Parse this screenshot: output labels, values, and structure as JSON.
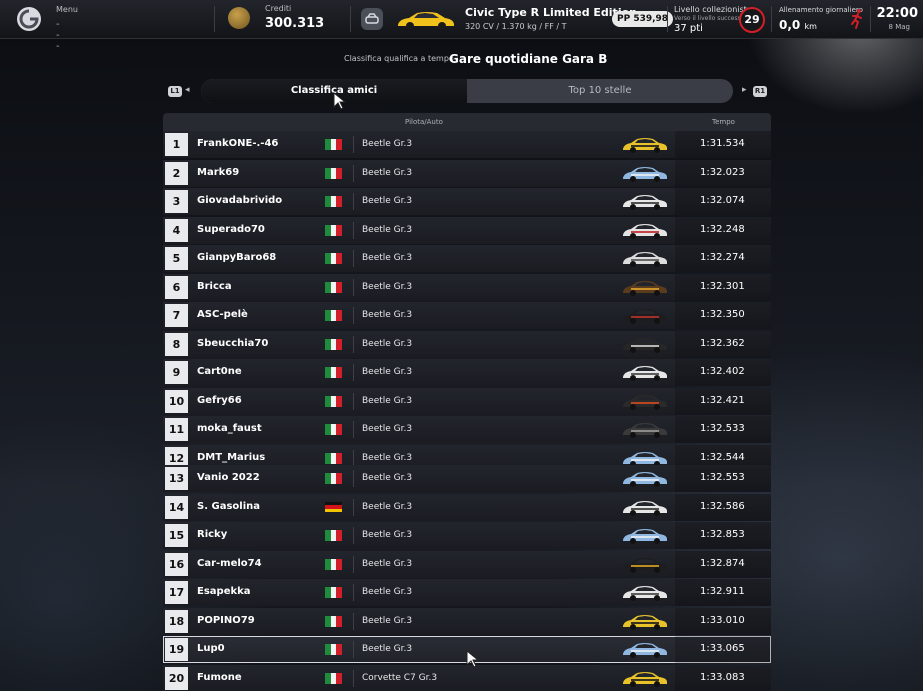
{
  "topbar": {
    "menu_label": "Menu",
    "menu_value": "---",
    "credits_label": "Crediti",
    "credits_value": "300.313",
    "car_name": "Civic Type R Limited Edition ...",
    "car_specs": "320 CV / 1.370 kg / FF / T",
    "pp": "PP 539,98",
    "level_label": "Livello collezionista",
    "level_sub": "Verso il livello successivo",
    "level_pts": "37 pti",
    "level_number": "29",
    "training_label": "Allenamento giornaliero",
    "training_value": "0,0",
    "training_unit": "km",
    "clock_time": "22:00",
    "clock_date": "8 Mag"
  },
  "header": {
    "subtitle": "Classifica qualifica a tempo",
    "title": "Gare quotidiane Gara B"
  },
  "tabs": {
    "left_button": "L1",
    "right_button": "R1",
    "friends": "Classifica amici",
    "top10": "Top 10 stelle"
  },
  "table": {
    "col_driver": "Pilota/Auto",
    "col_time": "Tempo",
    "rows": [
      {
        "pos": "1",
        "name": "FrankONE-.-46",
        "flag": "it",
        "car": "Beetle Gr.3",
        "livery": [
          "#e8c22a",
          "#1b1b1b"
        ],
        "time": "1:31.534"
      },
      {
        "pos": "2",
        "name": "Mark69",
        "flag": "it",
        "car": "Beetle Gr.3",
        "livery": [
          "#8fb7e0",
          "#e9eef4"
        ],
        "time": "1:32.023"
      },
      {
        "pos": "3",
        "name": "Giovadabrivido",
        "flag": "it",
        "car": "Beetle Gr.3",
        "livery": [
          "#e6e6e6",
          "#333333"
        ],
        "time": "1:32.074"
      },
      {
        "pos": "4",
        "name": "Superado70",
        "flag": "it",
        "car": "Beetle Gr.3",
        "livery": [
          "#e4e4e4",
          "#c0262b"
        ],
        "time": "1:32.248"
      },
      {
        "pos": "5",
        "name": "GianpyBaro68",
        "flag": "it",
        "car": "Beetle Gr.3",
        "livery": [
          "#dcdcdc",
          "#555555"
        ],
        "time": "1:32.274"
      },
      {
        "pos": "6",
        "name": "Bricca",
        "flag": "it",
        "car": "Beetle Gr.3",
        "livery": [
          "#5a3b1d",
          "#e0a22a"
        ],
        "time": "1:32.301"
      },
      {
        "pos": "7",
        "name": "ASC-pelè",
        "flag": "it",
        "car": "Beetle Gr.3",
        "livery": [
          "#1d1d1f",
          "#b8322a"
        ],
        "time": "1:32.350"
      },
      {
        "pos": "8",
        "name": "Sbeucchia70",
        "flag": "it",
        "car": "Beetle Gr.3",
        "livery": [
          "#262626",
          "#cfcfcf"
        ],
        "time": "1:32.362"
      },
      {
        "pos": "9",
        "name": "Cart0ne",
        "flag": "it",
        "car": "Beetle Gr.3",
        "livery": [
          "#e6e6e6",
          "#444444"
        ],
        "time": "1:32.402"
      },
      {
        "pos": "10",
        "name": "Gefry66",
        "flag": "it",
        "car": "Beetle Gr.3",
        "livery": [
          "#2a2a2a",
          "#d34a1f"
        ],
        "time": "1:32.421"
      },
      {
        "pos": "11",
        "name": "moka_faust",
        "flag": "it",
        "car": "Beetle Gr.3",
        "livery": [
          "#3a3a3a",
          "#9a9a9a"
        ],
        "time": "1:32.533"
      },
      {
        "pos": "12",
        "name": "DMT_Marius",
        "flag": "it",
        "car": "Beetle Gr.3",
        "livery": [
          "#8fb7e0",
          "#e9eef4"
        ],
        "time": "1:32.544"
      },
      {
        "pos": "13",
        "name": "Vanio 2022",
        "flag": "it",
        "car": "Beetle Gr.3",
        "livery": [
          "#8fb7e0",
          "#e9eef4"
        ],
        "time": "1:32.553"
      },
      {
        "pos": "14",
        "name": "S. Gasolina",
        "flag": "de",
        "car": "Beetle Gr.3",
        "livery": [
          "#e6e6e6",
          "#333333"
        ],
        "time": "1:32.586"
      },
      {
        "pos": "15",
        "name": "Ricky",
        "flag": "it",
        "car": "Beetle Gr.3",
        "livery": [
          "#8fb7e0",
          "#e9eef4"
        ],
        "time": "1:32.853"
      },
      {
        "pos": "16",
        "name": "Car-melo74",
        "flag": "it",
        "car": "Beetle Gr.3",
        "livery": [
          "#1d1d1f",
          "#d7a020"
        ],
        "time": "1:32.874"
      },
      {
        "pos": "17",
        "name": "Esapekka",
        "flag": "it",
        "car": "Beetle Gr.3",
        "livery": [
          "#e6e6e6",
          "#444444"
        ],
        "time": "1:32.911"
      },
      {
        "pos": "18",
        "name": "POPINO79",
        "flag": "it",
        "car": "Beetle Gr.3",
        "livery": [
          "#e8c22a",
          "#1b1b1b"
        ],
        "time": "1:33.010"
      },
      {
        "pos": "19",
        "name": "Lup0",
        "flag": "it",
        "car": "Beetle Gr.3",
        "livery": [
          "#8fb7e0",
          "#e9eef4"
        ],
        "time": "1:33.065"
      },
      {
        "pos": "20",
        "name": "Fumone",
        "flag": "it",
        "car": "Corvette C7 Gr.3",
        "livery": [
          "#e8c22a",
          "#1b1b1b"
        ],
        "time": "1:33.083"
      }
    ]
  },
  "colors": {
    "accent_red": "#d21e27",
    "selected_outline": "#d8dadf",
    "car_yellow": "#f0c21b"
  }
}
